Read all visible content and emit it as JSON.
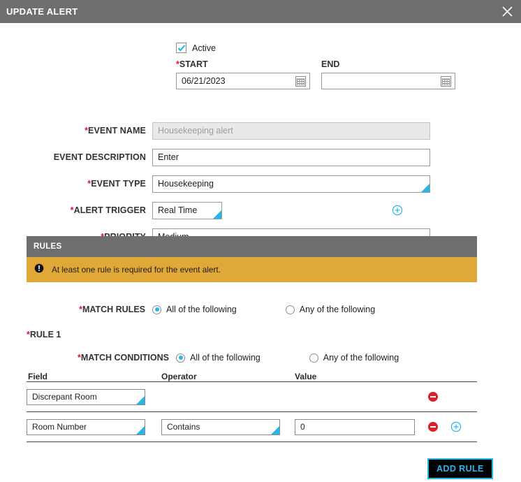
{
  "window": {
    "title": "UPDATE ALERT",
    "close_icon": "close-icon"
  },
  "form": {
    "active_checkbox": {
      "label": "Active",
      "checked": true
    },
    "start": {
      "label": "START",
      "required": true,
      "value": "06/21/2023"
    },
    "end": {
      "label": "END",
      "required": false,
      "value": ""
    },
    "fields": [
      {
        "label": "EVENT NAME",
        "required": true,
        "value": "Housekeeping alert",
        "state": "readonly",
        "type": "text"
      },
      {
        "label": "EVENT DESCRIPTION",
        "required": false,
        "value": "Enter",
        "state": "placeholder",
        "type": "text"
      },
      {
        "label": "EVENT TYPE",
        "required": true,
        "value": "Housekeeping",
        "state": "normal",
        "type": "dropdown"
      },
      {
        "label": "ALERT TRIGGER",
        "required": true,
        "value": "Real Time",
        "state": "normal",
        "type": "dropdown-narrow"
      },
      {
        "label": "PRIORITY",
        "required": true,
        "value": "Medium",
        "state": "normal",
        "type": "dropdown"
      }
    ]
  },
  "rules": {
    "header": "RULES",
    "warning": {
      "icon": "alert-circle-icon",
      "text": "At least one rule is required for the event alert."
    },
    "match_rules": {
      "label": "MATCH RULES",
      "required": true,
      "options": [
        "All of the following",
        "Any of the following"
      ],
      "selected": "All of the following"
    },
    "rule_title": "RULE 1",
    "match_conditions": {
      "label": "MATCH CONDITIONS",
      "required": true,
      "options": [
        "All of the following",
        "Any of the following"
      ],
      "selected": "All of the following"
    },
    "columns": [
      "Field",
      "Operator",
      "Value"
    ],
    "rows": [
      {
        "field": "Discrepant Room",
        "operator": "",
        "value": "",
        "has_operator": false,
        "has_value": false,
        "has_add": false
      },
      {
        "field": "Room Number",
        "operator": "Contains",
        "value": "0",
        "has_operator": true,
        "has_value": true,
        "has_add": true
      }
    ],
    "add_rule_label": "ADD RULE"
  },
  "colors": {
    "accent": "#29b6e8",
    "titlebar": "#6e6e6e",
    "warning": "#e0a837",
    "required": "#e8112d",
    "delete": "#d81f2a"
  }
}
